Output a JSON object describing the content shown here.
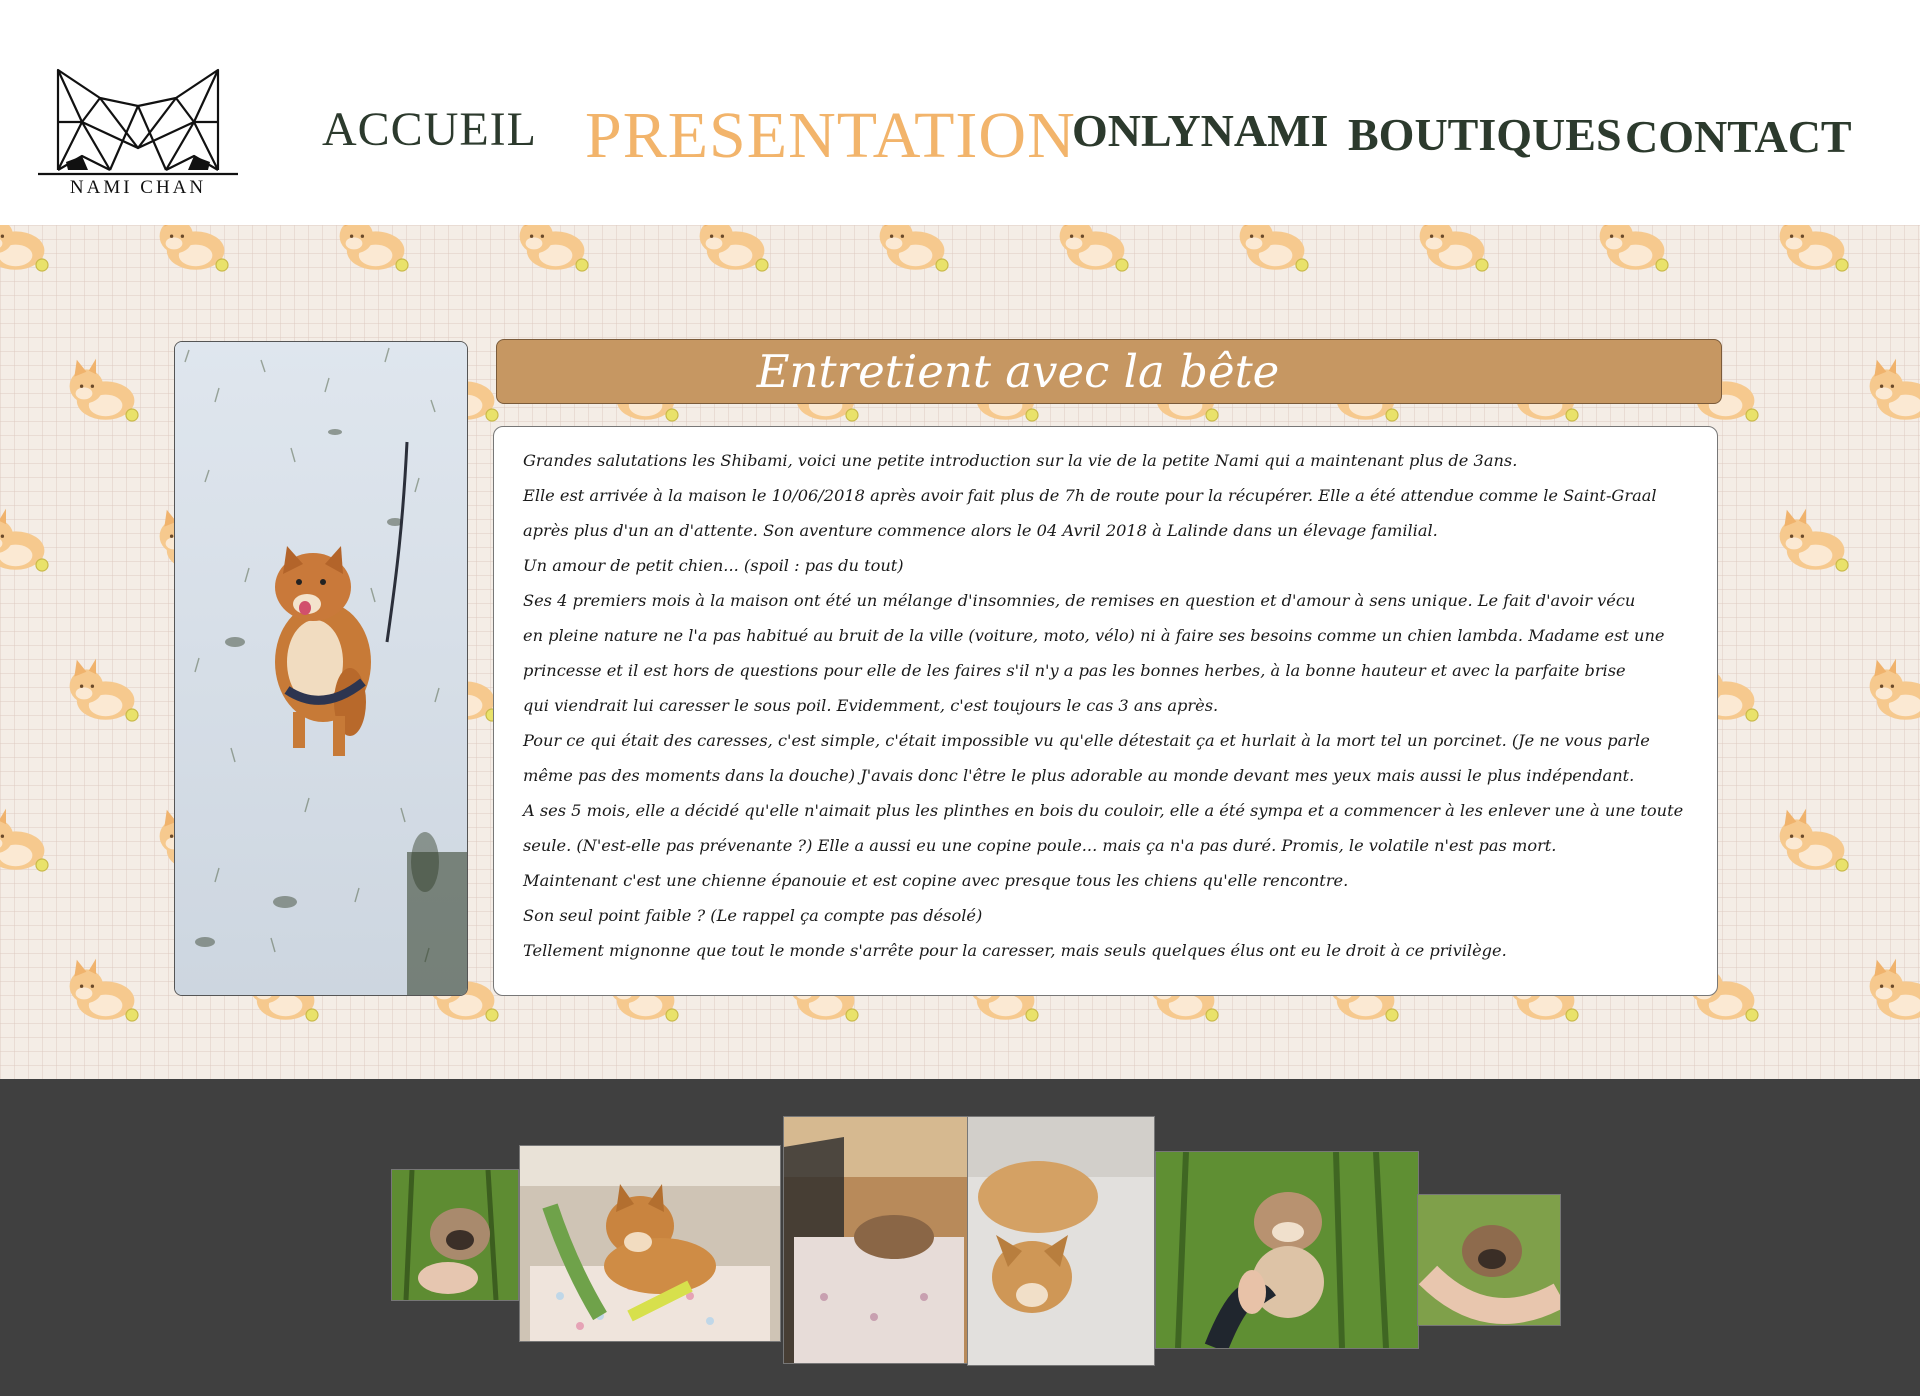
{
  "brand": {
    "logo_text": "NAMI CHAN"
  },
  "nav": {
    "accueil": "ACCUEIL",
    "presentation": "PRESENTATION",
    "onlynami": "ONLYNAMI",
    "boutiques": "BOUTIQUES",
    "contact": "CONTACT",
    "active_color": "#f2b46b",
    "default_color": "#2c3a2d"
  },
  "article": {
    "title": "Entretient avec la bête",
    "lines": [
      "Grandes salutations les Shibami, voici une petite introduction sur la vie de la petite Nami qui a maintenant plus de 3ans.",
      "Elle est arrivée à la maison le 10/06/2018 après avoir fait plus de 7h de route pour la récupérer. Elle a été attendue comme le Saint-Graal",
      "après plus d'un an d'attente. Son aventure commence alors le 04 Avril 2018 à Lalinde dans un élevage familial.",
      "Un amour de petit chien... (spoil : pas du tout)",
      "Ses 4 premiers mois à la maison ont été un mélange d'insomnies, de remises en question et d'amour à sens unique. Le fait d'avoir vécu",
      "en pleine nature ne l'a pas habitué au bruit de la ville (voiture, moto, vélo) ni à faire ses besoins comme un chien lambda. Madame est une",
      "princesse et il est hors de questions pour elle de les faires s'il n'y a pas les bonnes herbes, à la bonne hauteur et avec la parfaite brise",
      "qui viendrait lui caresser le sous poil. Evidemment, c'est toujours le cas 3 ans après.",
      "Pour ce qui était des caresses, c'est simple, c'était impossible vu qu'elle détestait ça et hurlait à la mort tel un porcinet. (Je ne vous parle",
      "même pas des moments dans la douche) J'avais donc l'être le plus adorable au monde devant mes yeux mais aussi le plus indépendant.",
      "A ses 5 mois, elle a décidé qu'elle n'aimait plus les plinthes en bois du couloir, elle a été sympa et a commencer à les enlever une à une toute",
      "seule. (N'est-elle pas prévenante ?) Elle a aussi eu une copine poule... mais ça n'a pas duré. Promis, le volatile n'est pas mort.",
      "Maintenant c'est une chienne épanouie et est copine avec presque tous les chiens qu'elle rencontre.",
      "Son seul point faible ? (Le rappel ça compte pas désolé)",
      "Tellement mignonne que tout le monde s'arrête pour la caresser, mais seuls quelques élus ont eu le droit à ce privilège."
    ]
  },
  "colors": {
    "title_bar": "#c69762",
    "pattern_bg": "#f4ede6",
    "footer_bg": "#404040"
  }
}
